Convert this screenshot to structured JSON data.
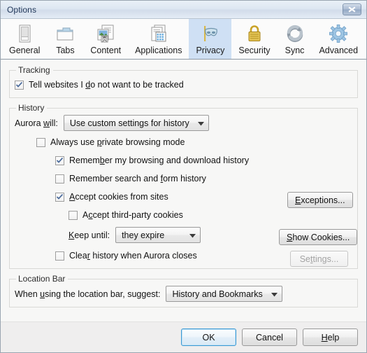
{
  "window": {
    "title": "Options",
    "close_icon": "close-icon"
  },
  "tabs": [
    {
      "label": "General",
      "icon": "general-icon",
      "selected": false
    },
    {
      "label": "Tabs",
      "icon": "tabs-icon",
      "selected": false
    },
    {
      "label": "Content",
      "icon": "content-icon",
      "selected": false
    },
    {
      "label": "Applications",
      "icon": "applications-icon",
      "selected": false
    },
    {
      "label": "Privacy",
      "icon": "privacy-mask-icon",
      "selected": true
    },
    {
      "label": "Security",
      "icon": "padlock-icon",
      "selected": false
    },
    {
      "label": "Sync",
      "icon": "sync-arrows-icon",
      "selected": false
    },
    {
      "label": "Advanced",
      "icon": "gear-icon",
      "selected": false
    }
  ],
  "tracking": {
    "legend": "Tracking",
    "do_not_track": {
      "pre": "Tell websites I ",
      "accel": "d",
      "post": "o not want to be tracked",
      "checked": true
    }
  },
  "history": {
    "legend": "History",
    "aurora_will": {
      "pre": "Aurora ",
      "accel": "w",
      "post": "ill:"
    },
    "mode_dropdown": {
      "value": "Use custom settings for history",
      "arrow": "chevron-down-icon"
    },
    "always_private": {
      "pre": "Always use ",
      "accel": "p",
      "post": "rivate browsing mode",
      "checked": false
    },
    "remember_browsing": {
      "pre": "Remem",
      "accel": "b",
      "post": "er my browsing and download history",
      "checked": true
    },
    "remember_forms": {
      "pre": "Remember search and ",
      "accel": "f",
      "post": "orm history",
      "checked": false
    },
    "accept_cookies": {
      "pre": "",
      "accel": "A",
      "post": "ccept cookies from sites",
      "checked": true
    },
    "accept_thirdparty": {
      "pre": "A",
      "accel": "c",
      "post": "cept third-party cookies",
      "checked": false
    },
    "keep_until": {
      "pre": "",
      "accel": "K",
      "post": "eep until:"
    },
    "keep_until_dropdown": {
      "value": "they expire",
      "arrow": "chevron-down-icon"
    },
    "clear_on_close": {
      "pre": "Clea",
      "accel": "r",
      "post": " history when Aurora closes",
      "checked": false
    },
    "exceptions_button": {
      "pre": "",
      "accel": "E",
      "post": "xceptions...",
      "disabled": false
    },
    "show_cookies_button": {
      "pre": "",
      "accel": "S",
      "post": "how Cookies...",
      "disabled": false
    },
    "settings_button": {
      "pre": "Se",
      "accel": "t",
      "post": "tings...",
      "disabled": true
    }
  },
  "location_bar": {
    "legend": "Location Bar",
    "suggest_label": {
      "pre": "When ",
      "accel": "u",
      "post": "sing the location bar, suggest:"
    },
    "suggest_dropdown": {
      "value": "History and Bookmarks",
      "arrow": "chevron-down-icon"
    }
  },
  "footer": {
    "ok": {
      "pre": "OK",
      "accel": "",
      "post": ""
    },
    "cancel": {
      "pre": "Cancel",
      "accel": "",
      "post": ""
    },
    "help": {
      "pre": "",
      "accel": "H",
      "post": "elp"
    }
  },
  "colors": {
    "title_bar": "#dde7f2",
    "selected_tab": "#cfe0f4",
    "content_bg": "#f7f7f6",
    "footer_bg": "#efeeee",
    "default_button_outline": "#3c9ad4",
    "checkbox_check": "#4a6a9a"
  }
}
